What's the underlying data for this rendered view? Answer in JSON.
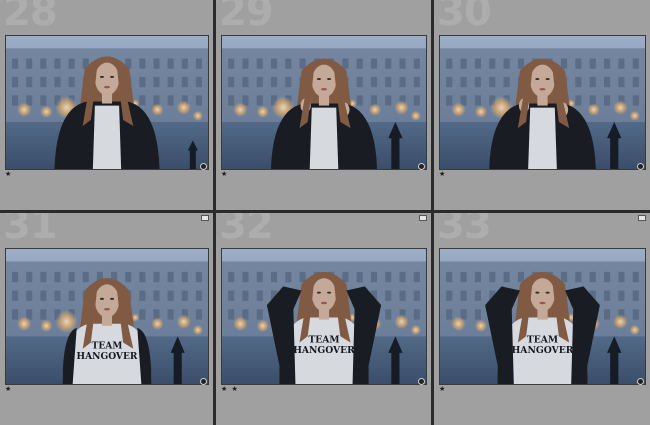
{
  "cells": [
    {
      "index": "28",
      "stars": "★",
      "pose": "a"
    },
    {
      "index": "29",
      "stars": "★",
      "pose": "b"
    },
    {
      "index": "30",
      "stars": "★",
      "pose": "b"
    },
    {
      "index": "31",
      "stars": "★",
      "pose": "c"
    },
    {
      "index": "32",
      "stars": "★ ★",
      "pose": "d"
    },
    {
      "index": "33",
      "stars": "★",
      "pose": "d"
    }
  ],
  "shirt_text": [
    "TEAM",
    "HANGOVER"
  ],
  "colors": {
    "cell_bg": "#a0a0a0",
    "gutter": "#2b2b2b",
    "sky": "#8fa3be",
    "building": "#6f7f95",
    "ground": "#3e5370",
    "jacket": "#151515",
    "hair": "#8a5a38",
    "skin": "#d9b49a",
    "shirt": "#ecebea",
    "lamp": "#f2b56a"
  },
  "icons": {
    "corner": "photo-settings-icon",
    "badge": "flag-icon"
  }
}
